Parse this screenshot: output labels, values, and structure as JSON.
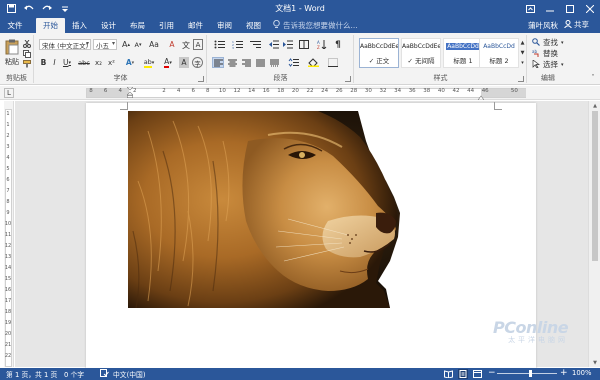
{
  "window": {
    "title": "文档1 - Word",
    "quick_access": [
      "save-icon",
      "undo-icon",
      "redo-icon",
      "customize-icon"
    ],
    "controls": [
      "ribbon-options-icon",
      "minimize-icon",
      "restore-icon",
      "close-icon"
    ]
  },
  "ribbon_tabs": {
    "file": "文件",
    "tabs": [
      "开始",
      "插入",
      "设计",
      "布局",
      "引用",
      "邮件",
      "审阅",
      "视图"
    ],
    "active": "开始",
    "tell_me_placeholder": "告诉我您想要做什么...",
    "user": "蒲叶风秋",
    "share": "共享"
  },
  "groups": {
    "clipboard": {
      "label": "剪贴板",
      "paste": "粘贴"
    },
    "font": {
      "label": "字体",
      "font_name": "宋体 (中文正文)",
      "font_size": "小五",
      "bold": "B",
      "italic": "I",
      "underline": "U",
      "strike": "abc",
      "subscript": "x₂",
      "superscript": "x²",
      "grow": "A",
      "shrink": "A",
      "case": "Aa",
      "clear": "A",
      "effects": "A",
      "char_border": "A",
      "highlight": "ab",
      "font_color": "A",
      "shading": "A",
      "enclose": "字"
    },
    "paragraph": {
      "label": "段落"
    },
    "styles": {
      "label": "样式",
      "items": [
        {
          "sample": "AaBbCcDdEe",
          "name": "正文"
        },
        {
          "sample": "AaBbCcDdEe",
          "name": "无间隔"
        },
        {
          "sample": "AaBbCcDd",
          "name": "标题 1"
        },
        {
          "sample": "AaBbCcDd",
          "name": "标题 2"
        }
      ]
    },
    "editing": {
      "label": "编辑",
      "find": "查找",
      "replace": "替换",
      "select": "选择"
    }
  },
  "ruler": {
    "numbers": [
      "8",
      "6",
      "4",
      "2",
      "",
      "2",
      "4",
      "6",
      "8",
      "10",
      "12",
      "14",
      "16",
      "18",
      "20",
      "22",
      "24",
      "26",
      "28",
      "30",
      "32",
      "34",
      "36",
      "38",
      "40",
      "42",
      "44",
      "46",
      "",
      "50"
    ],
    "tab_selector": "L",
    "vnumbers": [
      "1",
      "1",
      "2",
      "3",
      "4",
      "5",
      "6",
      "7",
      "8",
      "9",
      "10",
      "11",
      "12",
      "13",
      "14",
      "15",
      "16",
      "17",
      "18",
      "19",
      "20",
      "21",
      "22"
    ]
  },
  "document": {
    "image": "lion-photo"
  },
  "watermark": {
    "brand": "PConline",
    "sub": "太平洋电脑网"
  },
  "status": {
    "page": "第 1 页，共 1 页",
    "words": "0 个字",
    "language": "中文(中国)",
    "zoom": "100%",
    "views": [
      "read-mode-icon",
      "print-layout-icon",
      "web-layout-icon"
    ]
  },
  "colors": {
    "accent": "#2b579a",
    "ribbon_bg": "#f3f3f3",
    "workspace_bg": "#e6e6e6"
  }
}
